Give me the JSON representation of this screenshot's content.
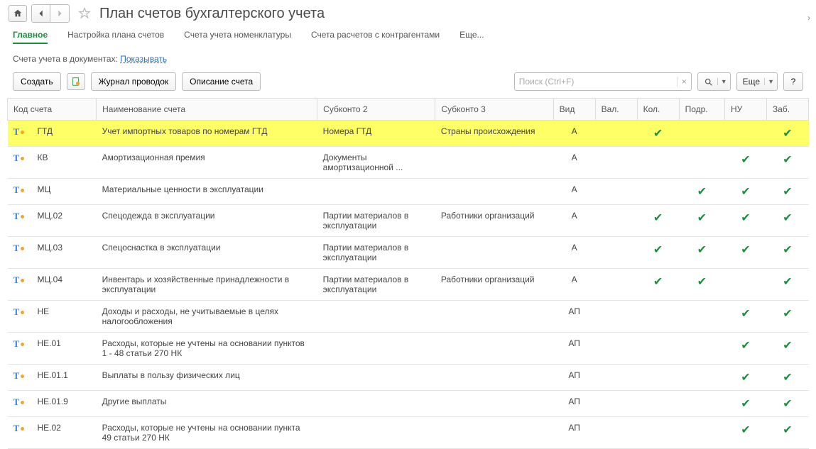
{
  "header": {
    "title": "План счетов бухгалтерского учета"
  },
  "tabs": [
    {
      "label": "Главное",
      "active": true
    },
    {
      "label": "Настройка плана счетов",
      "active": false
    },
    {
      "label": "Счета учета номенклатуры",
      "active": false
    },
    {
      "label": "Счета расчетов с контрагентами",
      "active": false
    },
    {
      "label": "Еще...",
      "active": false
    }
  ],
  "info": {
    "prefix": "Счета учета в документах: ",
    "link": "Показывать"
  },
  "toolbar": {
    "create": "Создать",
    "journal": "Журнал проводок",
    "description": "Описание счета",
    "search_placeholder": "Поиск (Ctrl+F)",
    "more": "Еще",
    "help": "?"
  },
  "columns": {
    "code": "Код счета",
    "name": "Наименование счета",
    "sub2": "Субконто 2",
    "sub3": "Субконто 3",
    "vid": "Вид",
    "val": "Вал.",
    "kol": "Кол.",
    "podr": "Подр.",
    "nu": "НУ",
    "zab": "Заб."
  },
  "rows": [
    {
      "code": "ГТД",
      "name": "Учет импортных товаров по номерам ГТД",
      "sub2": "Номера ГТД",
      "sub3": "Страны происхождения",
      "vid": "А",
      "val": false,
      "kol": true,
      "podr": false,
      "nu": false,
      "zab": true,
      "selected": true
    },
    {
      "code": "КВ",
      "name": "Амортизационная премия",
      "sub2": "Документы амортизационной ...",
      "sub3": "",
      "vid": "А",
      "val": false,
      "kol": false,
      "podr": false,
      "nu": true,
      "zab": true
    },
    {
      "code": "МЦ",
      "name": "Материальные ценности в эксплуатации",
      "sub2": "",
      "sub3": "",
      "vid": "А",
      "val": false,
      "kol": false,
      "podr": true,
      "nu": true,
      "zab": true
    },
    {
      "code": "МЦ.02",
      "name": "Спецодежда в эксплуатации",
      "sub2": "Партии материалов в эксплуатации",
      "sub3": "Работники организаций",
      "vid": "А",
      "val": false,
      "kol": true,
      "podr": true,
      "nu": true,
      "zab": true
    },
    {
      "code": "МЦ.03",
      "name": "Спецоснастка в эксплуатации",
      "sub2": "Партии материалов в эксплуатации",
      "sub3": "",
      "vid": "А",
      "val": false,
      "kol": true,
      "podr": true,
      "nu": true,
      "zab": true
    },
    {
      "code": "МЦ.04",
      "name": "Инвентарь и хозяйственные принадлежности в эксплуатации",
      "sub2": "Партии материалов в эксплуатации",
      "sub3": "Работники организаций",
      "vid": "А",
      "val": false,
      "kol": true,
      "podr": true,
      "nu": false,
      "zab": true
    },
    {
      "code": "НЕ",
      "name": "Доходы и расходы, не учитываемые в целях налогообложения",
      "sub2": "",
      "sub3": "",
      "vid": "АП",
      "val": false,
      "kol": false,
      "podr": false,
      "nu": true,
      "zab": true
    },
    {
      "code": "НЕ.01",
      "name": "Расходы, которые не учтены на основании пунктов 1 - 48 статьи 270 НК",
      "sub2": "",
      "sub3": "",
      "vid": "АП",
      "val": false,
      "kol": false,
      "podr": false,
      "nu": true,
      "zab": true
    },
    {
      "code": "НЕ.01.1",
      "name": "Выплаты в пользу физических лиц",
      "sub2": "",
      "sub3": "",
      "vid": "АП",
      "val": false,
      "kol": false,
      "podr": false,
      "nu": true,
      "zab": true
    },
    {
      "code": "НЕ.01.9",
      "name": "Другие выплаты",
      "sub2": "",
      "sub3": "",
      "vid": "АП",
      "val": false,
      "kol": false,
      "podr": false,
      "nu": true,
      "zab": true
    },
    {
      "code": "НЕ.02",
      "name": "Расходы, которые не учтены на основании пункта 49 статьи 270 НК",
      "sub2": "",
      "sub3": "",
      "vid": "АП",
      "val": false,
      "kol": false,
      "podr": false,
      "nu": true,
      "zab": true
    }
  ]
}
